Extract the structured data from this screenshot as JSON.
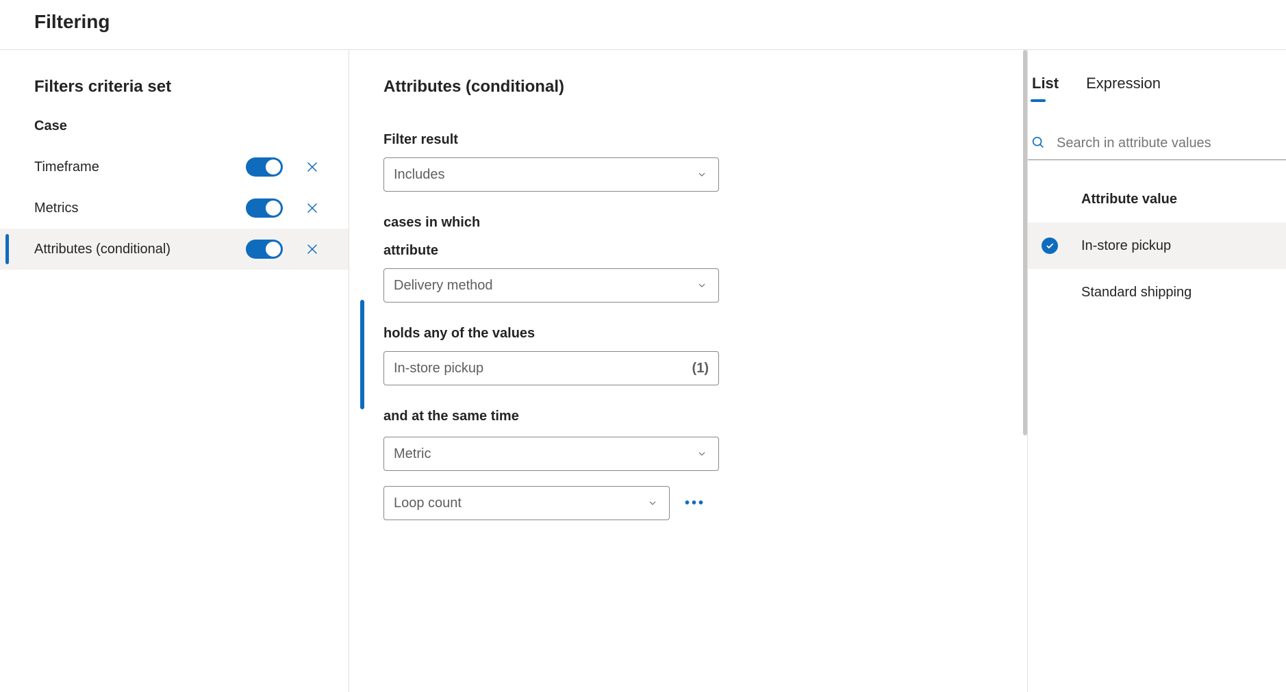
{
  "title": "Filtering",
  "left": {
    "section_title": "Filters criteria set",
    "group_label": "Case",
    "items": [
      {
        "label": "Timeframe",
        "enabled": true,
        "selected": false
      },
      {
        "label": "Metrics",
        "enabled": true,
        "selected": false
      },
      {
        "label": "Attributes (conditional)",
        "enabled": true,
        "selected": true
      }
    ]
  },
  "mid": {
    "section_title": "Attributes (conditional)",
    "filter_result_label": "Filter result",
    "filter_result_value": "Includes",
    "cases_in_which": "cases in which",
    "attribute_label": "attribute",
    "attribute_value": "Delivery method",
    "holds_label": "holds any of the values",
    "holds_value": "In-store pickup",
    "holds_count": "(1)",
    "and_same_time": "and at the same time",
    "metric_select": "Metric",
    "loop_select": "Loop count"
  },
  "right": {
    "tabs": {
      "list": "List",
      "expression": "Expression",
      "active": "list"
    },
    "search_placeholder": "Search in attribute values",
    "attr_header": "Attribute value",
    "values": [
      {
        "label": "In-store pickup",
        "selected": true
      },
      {
        "label": "Standard shipping",
        "selected": false
      }
    ]
  }
}
